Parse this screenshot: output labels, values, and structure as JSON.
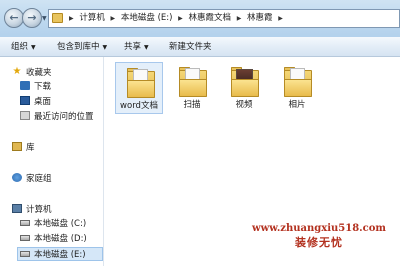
{
  "address": {
    "crumbs": [
      "计算机",
      "本地磁盘 (E:)",
      "林惠霞文档",
      "林惠霞"
    ]
  },
  "toolbar": {
    "organize": "组织",
    "include_in_library": "包含到库中",
    "share": "共享",
    "new_folder": "新建文件夹"
  },
  "nav": {
    "favorites": "收藏夹",
    "downloads": "下载",
    "desktop": "桌面",
    "recent": "最近访问的位置",
    "libraries": "库",
    "homegroup": "家庭组",
    "computer": "计算机",
    "drive_c": "本地磁盘 (C:)",
    "drive_d": "本地磁盘 (D:)",
    "drive_e": "本地磁盘 (E:)"
  },
  "files": [
    {
      "name": "word文档",
      "icon": "folder-document-icon"
    },
    {
      "name": "扫描",
      "icon": "folder-scan-icon"
    },
    {
      "name": "视频",
      "icon": "folder-video-icon"
    },
    {
      "name": "相片",
      "icon": "folder-photo-icon"
    }
  ],
  "watermark": {
    "url": "www.zhuangxiu518.com",
    "brand": "装修无忧"
  }
}
